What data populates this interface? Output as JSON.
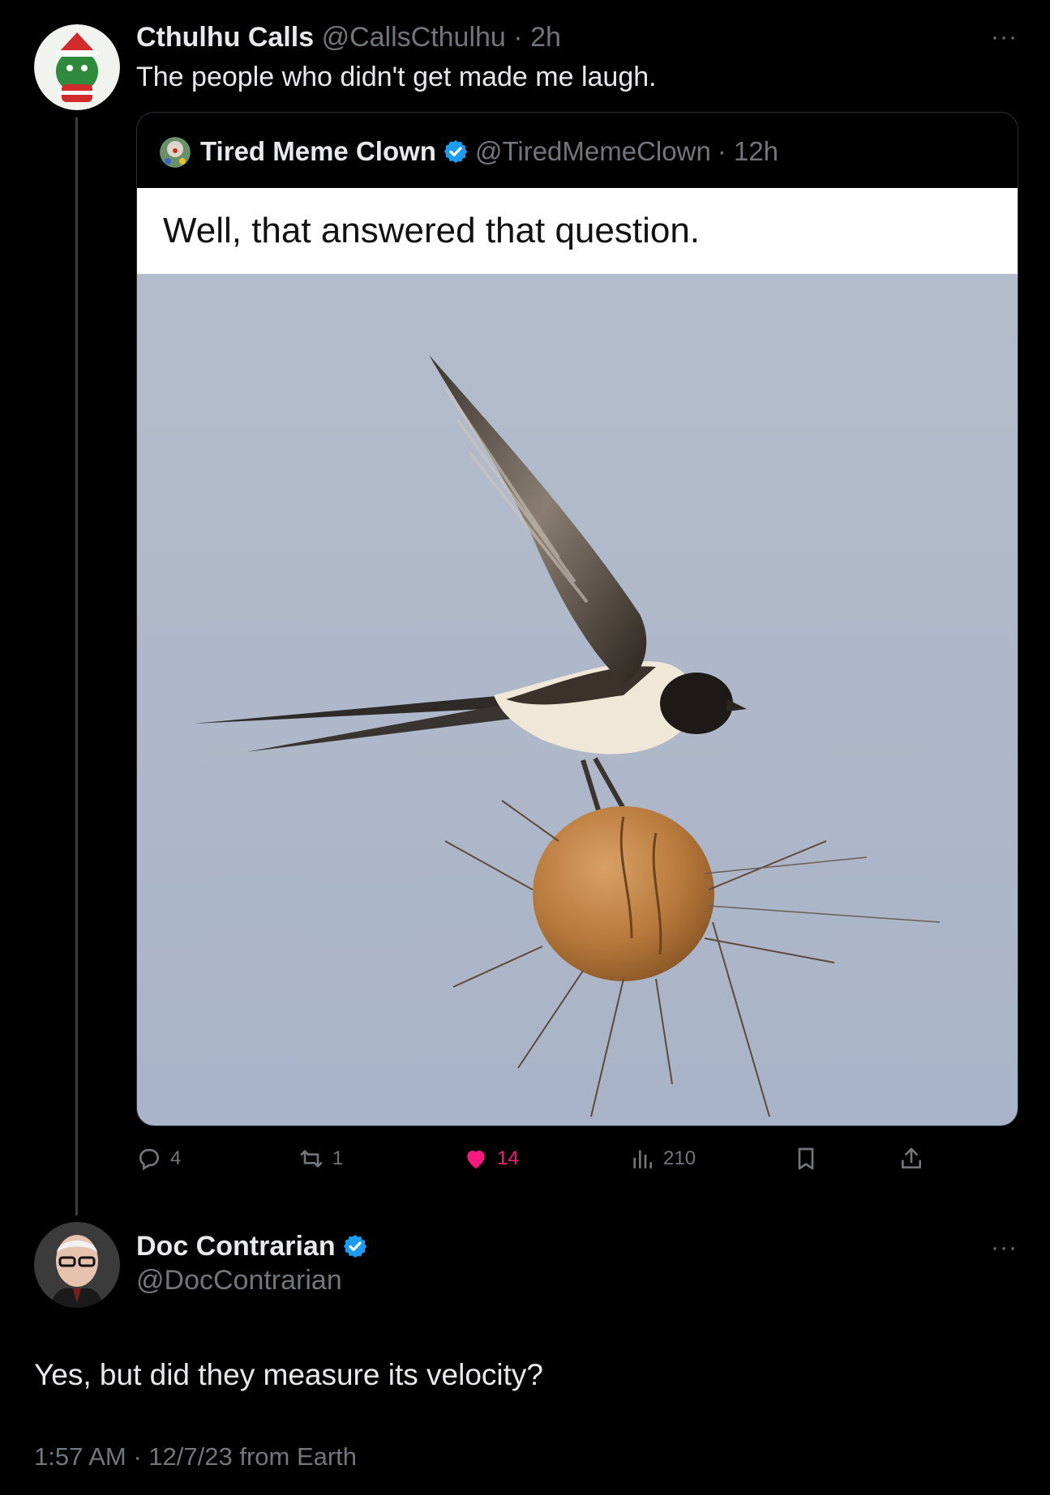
{
  "main_tweet": {
    "display_name": "Cthulhu Calls",
    "handle": "@CallsCthulhu",
    "time": "· 2h",
    "text": "The people who didn't get made me laugh.",
    "more": "···"
  },
  "quoted_tweet": {
    "display_name": "Tired Meme Clown",
    "handle": "@TiredMemeClown",
    "time": "· 12h",
    "verified": true,
    "meme_caption": "Well, that answered that question."
  },
  "actions": {
    "replies": "4",
    "retweets": "1",
    "likes": "14",
    "views": "210",
    "like_color": "#f91880"
  },
  "reply_tweet": {
    "display_name": "Doc Contrarian",
    "handle": "@DocContrarian",
    "verified": true,
    "text": "Yes, but did they measure its velocity?",
    "timestamp": "1:57 AM · 12/7/23 from Earth",
    "more": "···"
  },
  "colors": {
    "background": "#000000",
    "verified_blue": "#1d9bf0",
    "muted_text": "#71767b"
  }
}
